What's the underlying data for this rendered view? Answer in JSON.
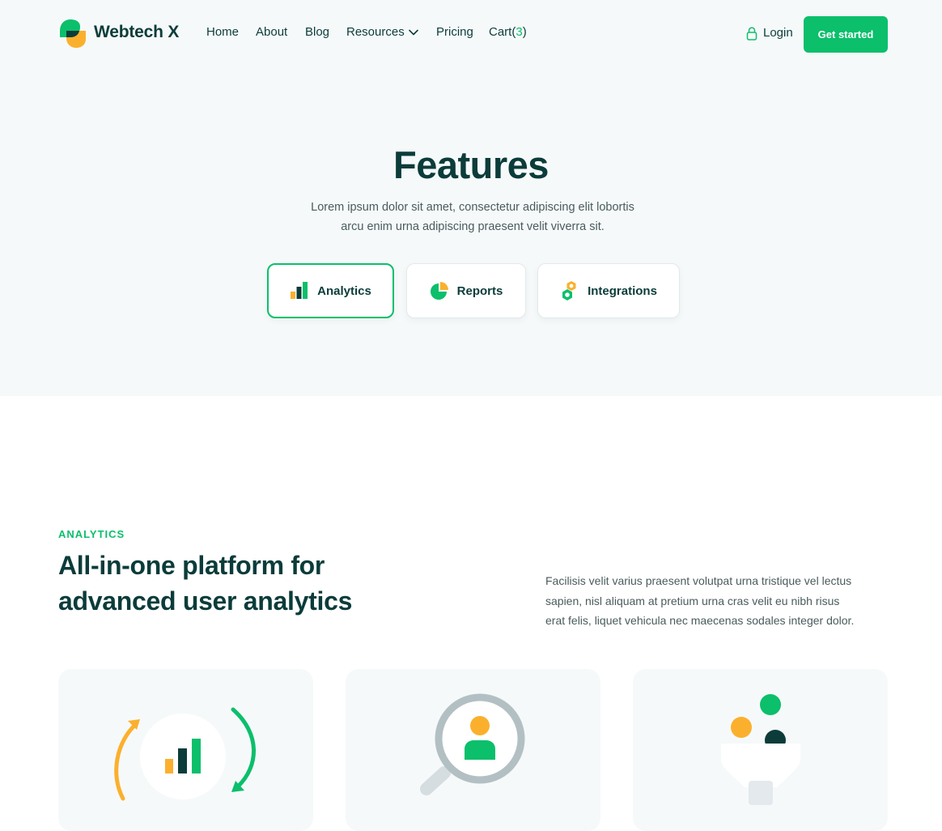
{
  "header": {
    "brand": "Webtech X",
    "nav": {
      "home": "Home",
      "about": "About",
      "blog": "Blog",
      "resources": "Resources",
      "pricing": "Pricing",
      "cart_label": "Cart(",
      "cart_count": "3",
      "cart_close": ")"
    },
    "login": "Login",
    "cta": "Get started"
  },
  "hero": {
    "title": "Features",
    "subtitle_line1": "Lorem ipsum dolor sit amet, consectetur adipiscing elit lobortis",
    "subtitle_line2": "arcu enim urna adipiscing praesent velit viverra sit.",
    "tabs": [
      {
        "label": "Analytics",
        "icon": "bar-chart-icon",
        "active": true
      },
      {
        "label": "Reports",
        "icon": "pie-chart-icon",
        "active": false
      },
      {
        "label": "Integrations",
        "icon": "hexagon-nut-icon",
        "active": false
      }
    ]
  },
  "analytics": {
    "eyebrow": "ANALYTICS",
    "heading_line1": "All-in-one platform for",
    "heading_line2": "advanced user analytics",
    "description_line1": "Facilisis velit varius praesent volutpat urna tristique vel lectus",
    "description_line2": "sapien, nisl aliquam at pretium urna cras velit eu nibh risus",
    "description_line3": "erat felis, liquet vehicula nec maecenas sodales integer dolor.",
    "cards": [
      {
        "illustration": "refresh-chart-icon"
      },
      {
        "illustration": "user-search-icon"
      },
      {
        "illustration": "funnel-icon"
      }
    ]
  },
  "colors": {
    "primary": "#0bbf6b",
    "dark": "#0b3c3a",
    "accent": "#fbb02d",
    "hero_bg": "#f6f9fa"
  }
}
